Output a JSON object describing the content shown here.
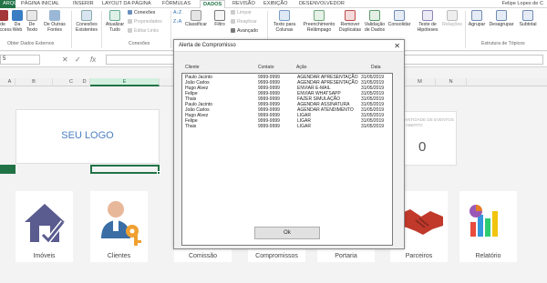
{
  "tabs": {
    "file": "ARQUIVO",
    "items": [
      "PÁGINA INICIAL",
      "INSERIR",
      "LAYOUT DA PÁGINA",
      "FÓRMULAS",
      "DADOS",
      "REVISÃO",
      "EXIBIÇÃO",
      "DESENVOLVEDOR"
    ],
    "active_index": 4
  },
  "user_name": "Felipe Lopes de C",
  "ribbon": {
    "get_data": {
      "from_access": "de\nAccess",
      "from_web": "Da\nWeb",
      "from_text": "De\nTexto",
      "other_sources": "De Outras\nFontes",
      "group_label": "Obter Dados Externos"
    },
    "existing_connections": "Conexões\nExistentes",
    "refresh_all": "Atualizar\nTudo",
    "connections": {
      "conexoes": "Conexões",
      "propriedades": "Propriedades",
      "editar_links": "Editar Links",
      "group_label": "Conexões"
    },
    "sort_filter": {
      "sort_az": "A↓Z",
      "sort_za": "Z↓A",
      "classificar": "Classificar",
      "filtro": "Filtro",
      "limpar": "Limpar",
      "reaplicar": "Reaplicar",
      "avancado": "Avançado"
    },
    "data_tools": {
      "text_to_columns": "Texto para\nColunas",
      "flash_fill": "Preenchimento\nRelâmpago",
      "remove_duplicates": "Remover\nDuplicatas",
      "data_validation": "Validação\nde Dados",
      "consolidate": "Consolidar",
      "what_if": "Teste de\nHipóteses",
      "relationships": "Relações"
    },
    "outline": {
      "group": "Agrupar",
      "ungroup": "Desagrupar",
      "subtotal": "Subtotal",
      "group_label": "Estrutura de Tópicos"
    }
  },
  "formula_bar": {
    "name_box": "5",
    "fx": "fx",
    "content": ""
  },
  "columns": [
    "A",
    "B",
    "C",
    "D",
    "E",
    "M",
    "N"
  ],
  "sheet": {
    "logo_text": "SEU LOGO",
    "kpi_label": "QUANTIDADE DE EVENTOS EM ABERTO",
    "kpi_value": "0",
    "cards": [
      "Imóveis",
      "Clientes",
      "Comissão",
      "Compromissos",
      "Portaria",
      "Parceiros",
      "Relatório"
    ]
  },
  "dialog": {
    "title": "Alerta de Compromisso",
    "close": "✕",
    "headers": [
      "Cliente",
      "Contato",
      "Ação",
      "Data"
    ],
    "rows": [
      [
        "Paulo Jacinto",
        "9999-9999",
        "AGENDAR APRESENTAÇÃO",
        "31/05/2019"
      ],
      [
        "João Carlos",
        "9999-9999",
        "AGENDAR APRESENTAÇÃO",
        "31/05/2019"
      ],
      [
        "Hugo Alvez",
        "9999-9999",
        "ENVIAR E-MAIL",
        "31/05/2019"
      ],
      [
        "Felipe",
        "9999-9999",
        "ENVIAR WHATSAPP",
        "31/05/2019"
      ],
      [
        "Thais",
        "9999-9999",
        "FAZER SIMULAÇÃO",
        "31/05/2019"
      ],
      [
        "Paulo Jacinto",
        "9999-9999",
        "AGENDAR ASSINATURA",
        "31/05/2019"
      ],
      [
        "João Carlos",
        "9999-9999",
        "AGENDAR ATENDIMENTO",
        "31/05/2019"
      ],
      [
        "Hugo Alvez",
        "9999-9999",
        "LIGAR",
        "31/05/2019"
      ],
      [
        "Felipe",
        "9999-9999",
        "LIGAR",
        "31/05/2019"
      ],
      [
        "Thais",
        "9999-9999",
        "LIGAR",
        "31/05/2019"
      ]
    ],
    "ok_label": "Ok"
  },
  "colors": {
    "excel_green": "#217346",
    "logo_blue": "#4a7fc1",
    "house_purple": "#5a5b8f",
    "key_orange": "#f0a030",
    "handshake_red": "#c0392b"
  }
}
